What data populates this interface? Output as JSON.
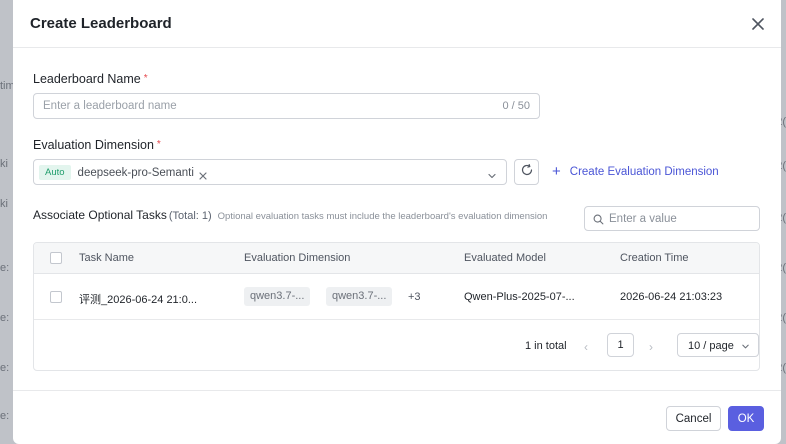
{
  "background": {
    "left_fragments": [
      "tim",
      "ki",
      "ki",
      "e:",
      "e:",
      "e:",
      "e:"
    ],
    "right_fragments": [
      "2(",
      "2(",
      "2(",
      "2(",
      "2(",
      "2("
    ]
  },
  "modal": {
    "title": "Create Leaderboard",
    "close_icon": "close-icon"
  },
  "leaderboard_name": {
    "label": "Leaderboard Name",
    "required_mark": "*",
    "placeholder": "Enter a leaderboard name",
    "value": "",
    "counter": "0 / 50"
  },
  "evaluation_dimension": {
    "label": "Evaluation Dimension",
    "required_mark": "*",
    "selected": [
      {
        "badge": "Auto",
        "text": "deepseek-pro-Semanti"
      }
    ],
    "create_link": "Create Evaluation Dimension",
    "refresh_icon": "refresh-icon"
  },
  "optional_tasks": {
    "title": "Associate Optional Tasks",
    "total": "(Total: 1)",
    "hint": "Optional evaluation tasks must include the leaderboard's evaluation dimension",
    "search_placeholder": "Enter a value",
    "columns": [
      "Task Name",
      "Evaluation Dimension",
      "Evaluated Model",
      "Creation Time"
    ],
    "rows": [
      {
        "task_name": "评测_2026-06-24 21:0...",
        "dimensions": [
          "qwen3.7-...",
          "qwen3.7-..."
        ],
        "more": "+3",
        "model": "Qwen-Plus-2025-07-...",
        "created": "2026-06-24 21:03:23"
      }
    ]
  },
  "pagination": {
    "total_text": "1 in total",
    "prev": "‹",
    "next": "›",
    "current_page": "1",
    "page_size": "10 / page"
  },
  "footer": {
    "cancel_label": "Cancel",
    "ok_label": "OK"
  },
  "colors": {
    "accent": "#5a5fe0",
    "link": "#4a55d6",
    "required": "#e5484d",
    "auto_badge": "#1f9d6b"
  }
}
